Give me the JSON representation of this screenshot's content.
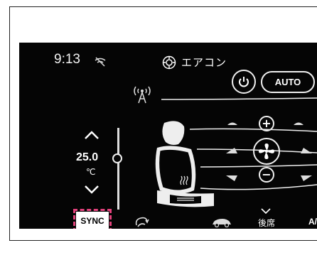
{
  "status": {
    "time": "9:13"
  },
  "header": {
    "title": "エアコン"
  },
  "controls": {
    "auto_label": "AUTO",
    "sync_label": "SYNC",
    "rear_label": "後席",
    "ac_label": "A/"
  },
  "temperature": {
    "value": "25.0",
    "unit": "℃"
  },
  "fan": {
    "plus_label": "+",
    "minus_label": "−"
  },
  "icons": {
    "wifi": "wifi-off-icon",
    "ac": "gear-icon",
    "antenna": "antenna-icon",
    "seat": "seat-heater-icon",
    "recirc": "recirculation-icon",
    "car": "car-icon"
  },
  "colors": {
    "highlight": "#e2417b",
    "background": "#050505",
    "foreground": "#ffffff"
  }
}
